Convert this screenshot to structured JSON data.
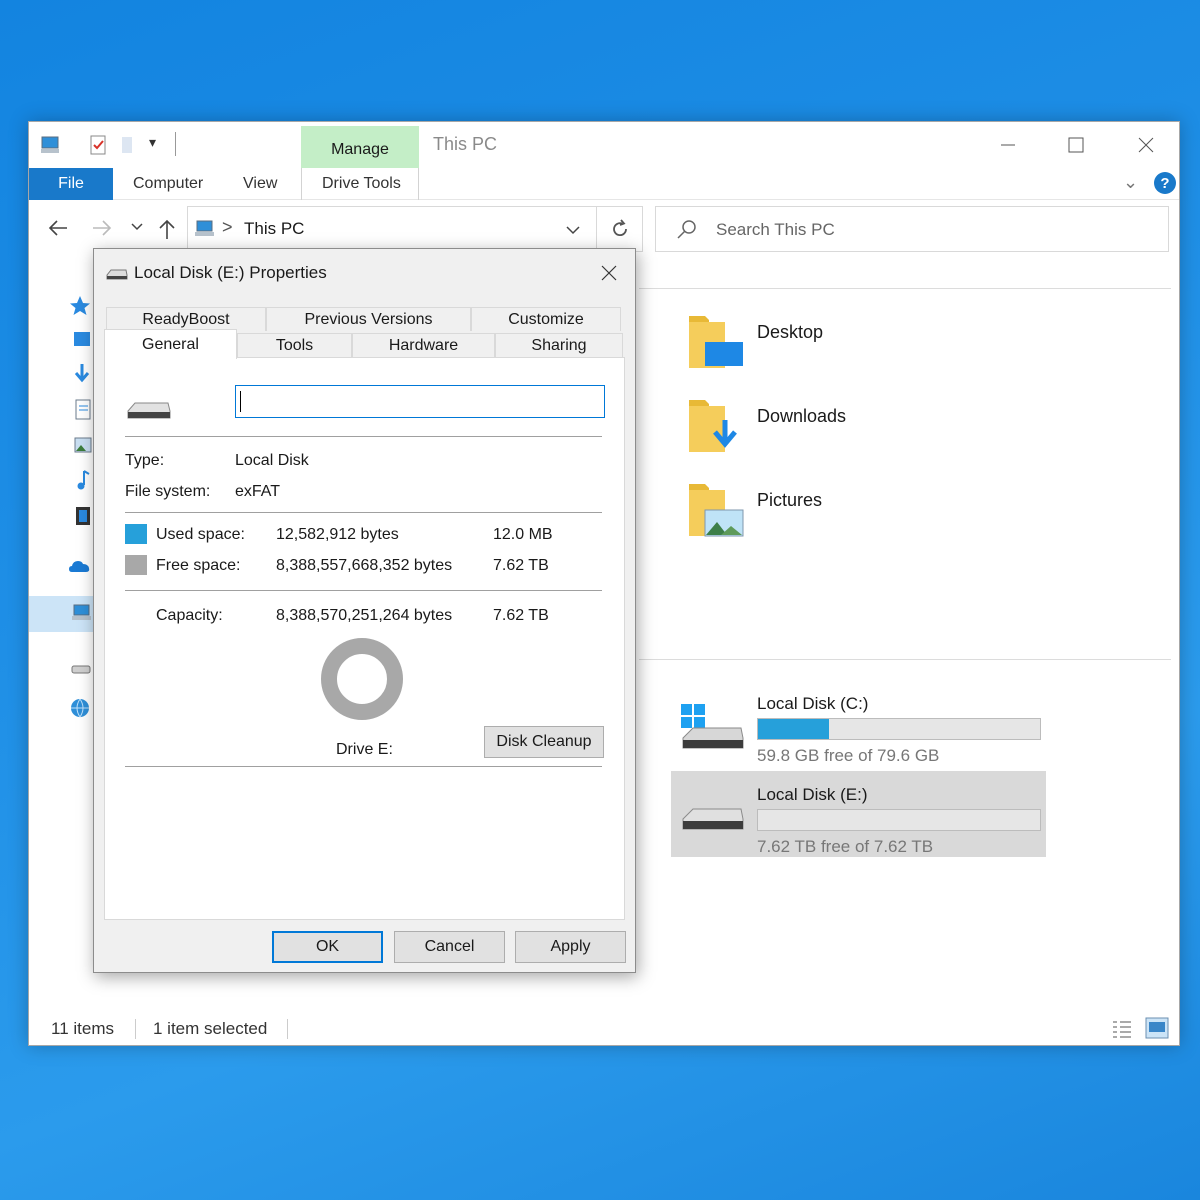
{
  "explorer": {
    "title": "This PC",
    "manage_tab": "Manage",
    "ribbon": {
      "file": "File",
      "computer": "Computer",
      "view": "View",
      "drive_tools": "Drive Tools"
    },
    "address": {
      "location": "This PC",
      "separator": ">"
    },
    "search": {
      "placeholder": "Search This PC"
    },
    "folders": [
      {
        "label": "Desktop",
        "icon": "desktop-folder-icon"
      },
      {
        "label": "Downloads",
        "icon": "downloads-folder-icon"
      },
      {
        "label": "Pictures",
        "icon": "pictures-folder-icon"
      }
    ],
    "drives": [
      {
        "label": "Local Disk (C:)",
        "free_text": "59.8 GB free of 79.6 GB",
        "used_fraction": 0.25,
        "selected": false
      },
      {
        "label": "Local Disk (E:)",
        "free_text": "7.62 TB free of 7.62 TB",
        "used_fraction": 0.0,
        "selected": true
      }
    ],
    "status": {
      "items": "11 items",
      "selected": "1 item selected"
    }
  },
  "dialog": {
    "title": "Local Disk (E:) Properties",
    "tabs_top": [
      "ReadyBoost",
      "Previous Versions",
      "Customize"
    ],
    "tabs_bottom": [
      "General",
      "Tools",
      "Hardware",
      "Sharing"
    ],
    "active_tab": "General",
    "name_value": "",
    "type_label": "Type:",
    "type_value": "Local Disk",
    "fs_label": "File system:",
    "fs_value": "exFAT",
    "used_label": "Used space:",
    "used_bytes": "12,582,912 bytes",
    "used_size": "12.0 MB",
    "free_label": "Free space:",
    "free_bytes": "8,388,557,668,352 bytes",
    "free_size": "7.62 TB",
    "capacity_label": "Capacity:",
    "capacity_bytes": "8,388,570,251,264 bytes",
    "capacity_size": "7.62 TB",
    "drive_label": "Drive E:",
    "disk_cleanup": "Disk Cleanup",
    "ok": "OK",
    "cancel": "Cancel",
    "apply": "Apply",
    "used_fraction": 1.5e-06
  },
  "colors": {
    "used_space": "#26a0da",
    "free_space": "#a8a8a8",
    "file_tab": "#1979ca",
    "manage_tab": "#c4eec7",
    "accent": "#0078d7"
  }
}
